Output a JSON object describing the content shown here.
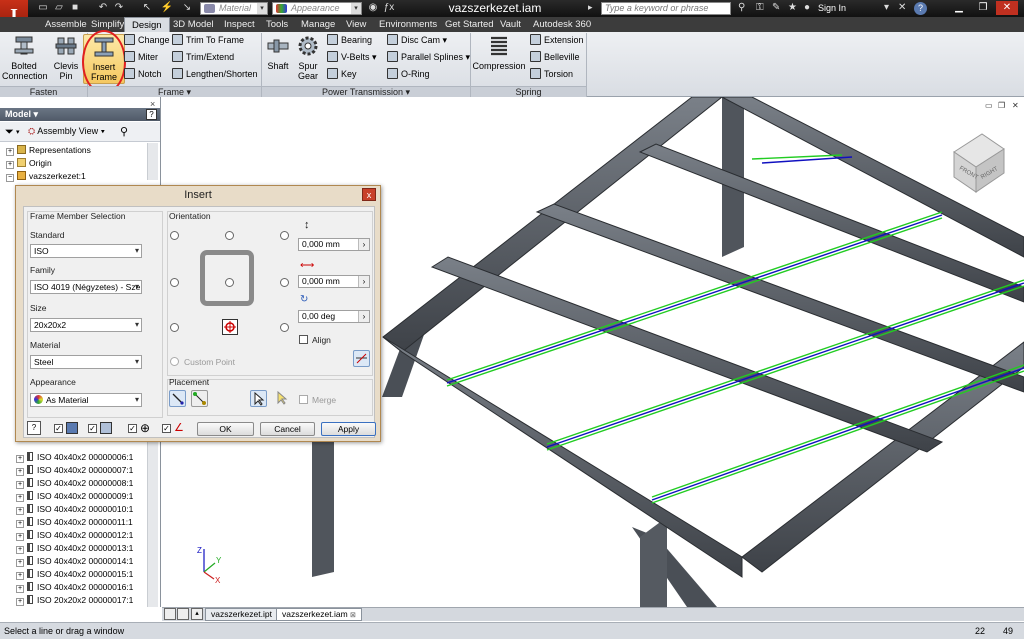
{
  "app": {
    "logo": "I",
    "title": "vazszerkezet.iam"
  },
  "qat": {
    "material_placeholder": "Material",
    "appearance_placeholder": "Appearance"
  },
  "search": {
    "placeholder": "Type a keyword or phrase"
  },
  "signin": "Sign In",
  "tabs": [
    "Assemble",
    "Simplify",
    "Design",
    "3D Model",
    "Inspect",
    "Tools",
    "Manage",
    "View",
    "Environments",
    "Get Started",
    "Vault",
    "Autodesk 360"
  ],
  "active_tab": "Design",
  "ribbon": {
    "fasten": {
      "label": "Fasten",
      "bolted": "Bolted\nConnection",
      "clevis": "Clevis\nPin"
    },
    "frame": {
      "label": "Frame ▾",
      "insert": "Insert\nFrame",
      "change": "Change",
      "miter": "Miter",
      "notch": "Notch",
      "trim_to_frame": "Trim To Frame",
      "trim_extend": "Trim/Extend",
      "lengthen": "Lengthen/Shorten"
    },
    "power": {
      "label": "Power Transmission ▾",
      "shaft": "Shaft",
      "spur": "Spur\nGear",
      "bearing": "Bearing",
      "vbelts": "V-Belts",
      "key": "Key",
      "disc_cam": "Disc Cam",
      "parallel_splines": "Parallel Splines",
      "oring": "O-Ring"
    },
    "spring": {
      "label": "Spring",
      "compression": "Compression",
      "extension": "Extension",
      "belleville": "Belleville",
      "torsion": "Torsion"
    }
  },
  "browser": {
    "title": "Model ▾",
    "view": "Assembly View",
    "top_items": [
      "Representations",
      "Origin",
      "vazszerkezet:1"
    ],
    "items": [
      "ISO 40x40x2 00000006:1",
      "ISO 40x40x2 00000007:1",
      "ISO 40x40x2 00000008:1",
      "ISO 40x40x2 00000009:1",
      "ISO 40x40x2 00000010:1",
      "ISO 40x40x2 00000011:1",
      "ISO 40x40x2 00000012:1",
      "ISO 40x40x2 00000013:1",
      "ISO 40x40x2 00000014:1",
      "ISO 40x40x2 00000015:1",
      "ISO 40x40x2 00000016:1",
      "ISO 20x20x2 00000017:1"
    ]
  },
  "dialog": {
    "title": "Insert",
    "close": "x",
    "member_selection": "Frame Member Selection",
    "standard_label": "Standard",
    "standard": "ISO",
    "family_label": "Family",
    "family": "ISO 4019 (Négyzetes) - Sze",
    "size_label": "Size",
    "size": "20x20x2",
    "material_label": "Material",
    "material": "Steel",
    "appearance_label": "Appearance",
    "appearance": "As Material",
    "orientation": "Orientation",
    "offset1": "0,000 mm",
    "offset2": "0,000 mm",
    "rotation": "0,00 deg",
    "align": "Align",
    "custom_point": "Custom Point",
    "placement": "Placement",
    "merge": "Merge",
    "ok": "OK",
    "cancel": "Cancel",
    "apply": "Apply"
  },
  "viewcube": {
    "front": "FRONT",
    "right": "RIGHT"
  },
  "doc_tabs": [
    "vazszerkezet.ipt",
    "vazszerkezet.iam"
  ],
  "status": {
    "text": "Select a line or drag a window",
    "n1": "22",
    "n2": "49"
  },
  "colors": {
    "accent": "#e02020",
    "frame": "#555b63",
    "sketch": "#22cc22",
    "selected": "#1010c0"
  }
}
